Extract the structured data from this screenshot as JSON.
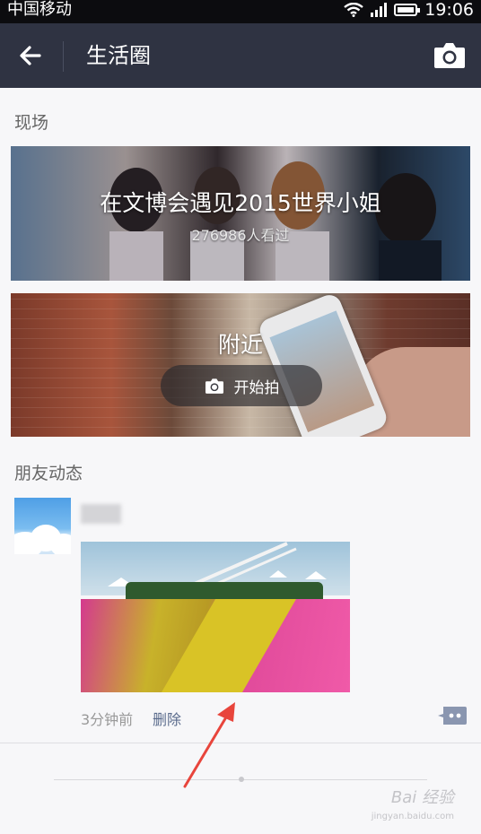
{
  "status_bar": {
    "carrier": "中国移动",
    "time": "19:06"
  },
  "header": {
    "title": "生活圈"
  },
  "live_section": {
    "title": "现场",
    "card": {
      "title": "在文博会遇见2015世界小姐",
      "views": "276986人看过"
    },
    "nearby": {
      "title": "附近",
      "action": "开始拍"
    }
  },
  "friends_section": {
    "title": "朋友动态",
    "post": {
      "time": "3分钟前",
      "delete": "删除"
    }
  },
  "watermark": {
    "text": "Bai 经验",
    "sub": "jingyan.baidu.com"
  },
  "colors": {
    "status_bar": "#0c0c0f",
    "top_bar": "#2f3342",
    "background": "#f7f7f9",
    "link": "#5a6b8c",
    "annotation_arrow": "#e8453c"
  }
}
